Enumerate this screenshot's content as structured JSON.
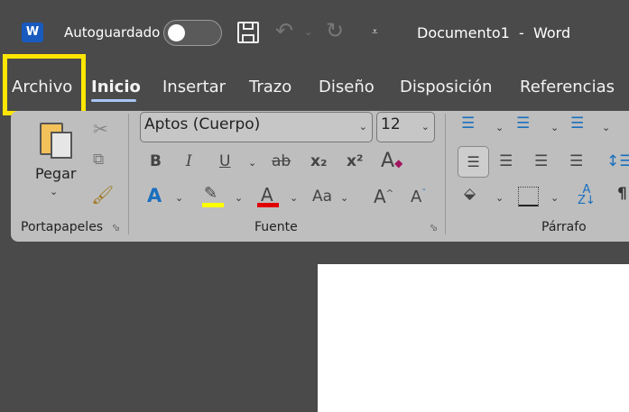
{
  "titlebar": {
    "app_icon": "word-icon",
    "autosave_label": "Autoguardado",
    "autosave_on": false,
    "doc_title": "Documento1  -  Word",
    "icons": [
      "save-icon",
      "undo-icon",
      "redo-icon",
      "customize-qat-icon"
    ]
  },
  "tabs": [
    {
      "label": "Archivo",
      "highlighted": true
    },
    {
      "label": "Inicio",
      "active": true
    },
    {
      "label": "Insertar"
    },
    {
      "label": "Trazo"
    },
    {
      "label": "Diseño"
    },
    {
      "label": "Disposición"
    },
    {
      "label": "Referencias"
    }
  ],
  "ribbon": {
    "clipboard": {
      "paste_label": "Pegar",
      "group_label": "Portapapeles"
    },
    "font": {
      "font_name": "Aptos (Cuerpo)",
      "font_size": "12",
      "group_label": "Fuente",
      "bold": "B",
      "italic": "I",
      "underline": "U",
      "strike": "ab",
      "subscript": "x₂",
      "superscript": "x²",
      "highlight_color": "#ffff00",
      "font_color": "#e00000"
    },
    "paragraph": {
      "group_label": "Párrafo"
    }
  },
  "colors": {
    "highlight_box": "#ffe600",
    "tab_underline": "#a9c4f5"
  }
}
